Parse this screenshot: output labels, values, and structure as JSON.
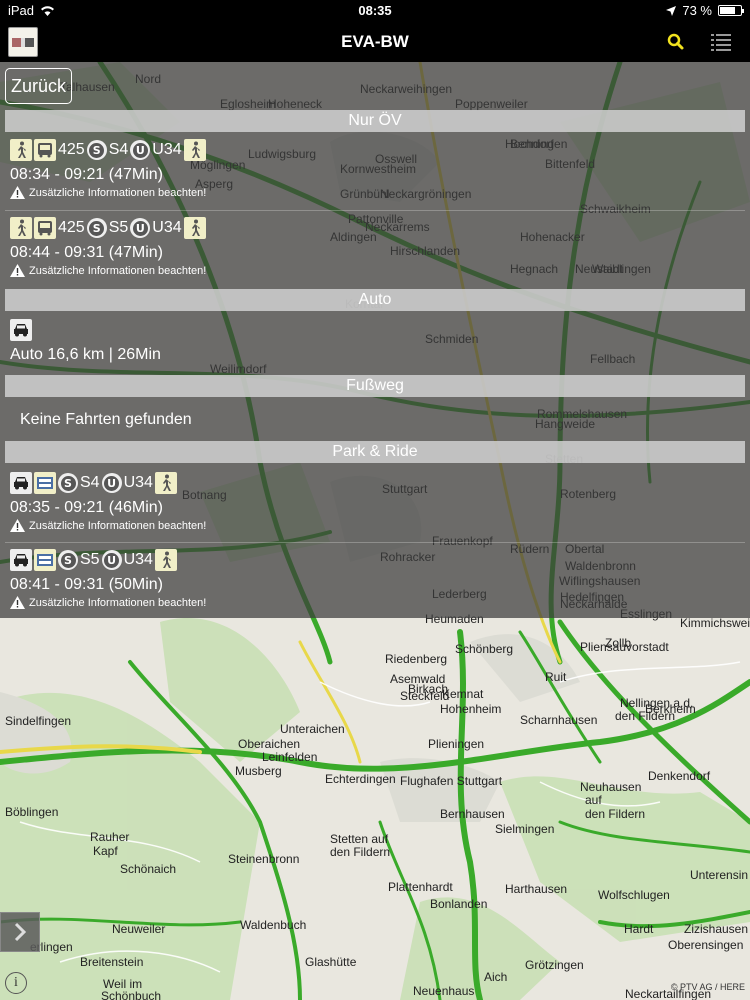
{
  "status_bar": {
    "device": "iPad",
    "time": "08:35",
    "battery": "73 %",
    "battery_level": 0.73
  },
  "header": {
    "title": "EVA-BW"
  },
  "back_label": "Zurück",
  "sections": {
    "oev": {
      "title": "Nur ÖV"
    },
    "auto": {
      "title": "Auto"
    },
    "walk": {
      "title": "Fußweg"
    },
    "pr": {
      "title": "Park & Ride"
    }
  },
  "connections": {
    "oev1": {
      "bus_line": "425",
      "s_line": "S4",
      "u_line": "U34",
      "s_icon": "S",
      "u_icon": "U",
      "time": "08:34 - 09:21 (47Min)",
      "note": "Zusätzliche Informationen beachten!"
    },
    "oev2": {
      "bus_line": "425",
      "s_line": "S5",
      "u_line": "U34",
      "s_icon": "S",
      "u_icon": "U",
      "time": "08:44 - 09:31 (47Min)",
      "note": "Zusätzliche Informationen beachten!"
    },
    "auto1": {
      "summary": "Auto 16,6 km | 26Min"
    },
    "walk_empty": "Keine Fahrten gefunden",
    "pr1": {
      "s_line": "S4",
      "u_line": "U34",
      "s_icon": "S",
      "u_icon": "U",
      "time": "08:35 - 09:21 (46Min)",
      "note": "Zusätzliche Informationen beachten!"
    },
    "pr2": {
      "s_line": "S5",
      "u_line": "U34",
      "s_icon": "S",
      "u_icon": "U",
      "time": "08:41 - 09:31 (50Min)",
      "note": "Zusätzliche Informationen beachten!"
    }
  },
  "map": {
    "copyright": "© PTV AG / HERE",
    "info": "i",
    "places": [
      "Talhausen",
      "Nord",
      "Eglosheim",
      "Hoheneck",
      "Neckarweihingen",
      "Poppenweiler",
      "Hochdorf",
      "Möglingen",
      "Ludwigsburg",
      "Osswell",
      "Benningen",
      "Bittenfeld",
      "Asperg",
      "Kornwestheim",
      "Grünbühl",
      "Neckargröningen",
      "Pattonville",
      "Aldingen",
      "Neckarrems",
      "Hohenacker",
      "Schwaikheim",
      "Hegnach",
      "Neustadt",
      "Hirschlanden",
      "Waiblingen",
      "Korntal",
      "Schmiden",
      "Weilimdorf",
      "Fellbach",
      "Rommelshausen",
      "Hangweide",
      "Botnang",
      "Stuttgart",
      "Rotenberg",
      "Stetten",
      "Frauenkopf",
      "Rohracker",
      "Rüdern",
      "Obertal",
      "Waldenbronn",
      "Wiflingshausen",
      "Lederberg",
      "Hedelfingen",
      "Neckarhalde",
      "Heumaden",
      "Esslingen",
      "Kimmichsweiler",
      "Riedenberg",
      "Pliensauvorstadt",
      "Schönberg",
      "Ruit",
      "Zollb",
      "Asemwald",
      "Birkach",
      "Kemnat",
      "Steckfeld",
      "Hohenheim",
      "Nellingen a.d.",
      "den Fildern",
      "Berkheim",
      "Sindelfingen",
      "Scharnhausen",
      "Unteraichen",
      "Oberaichen",
      "Plieningen",
      "Denkendorf",
      "Musberg",
      "Leinfelden",
      "Echterdingen",
      "Flughafen Stuttgart",
      "Böblingen",
      "Neuhausen",
      "auf",
      "den Fildern",
      "Bernhausen",
      "Sielmingen",
      "Rauher",
      "Kapf",
      "Steinenbronn",
      "Stetten auf",
      "den Fildern",
      "Schönaich",
      "Plattenhardt",
      "Harthausen",
      "Wolfschlugen",
      "Bonlanden",
      "Unterensin",
      "Neuweiler",
      "Waldenbuch",
      "Hardt",
      "Zizishausen",
      "Oberensingen",
      "erlingen",
      "Breitenstein",
      "Glashütte",
      "Grötzingen",
      "Weil im",
      "Schönbuch",
      "Neuenhaus",
      "Aich",
      "Neckartailfingen"
    ]
  },
  "colors": {
    "road_green": "#3aaa2a",
    "road_yellow": "#e8d84a",
    "overlay": "#3c3c3c",
    "search_icon": "#f1e21e"
  }
}
